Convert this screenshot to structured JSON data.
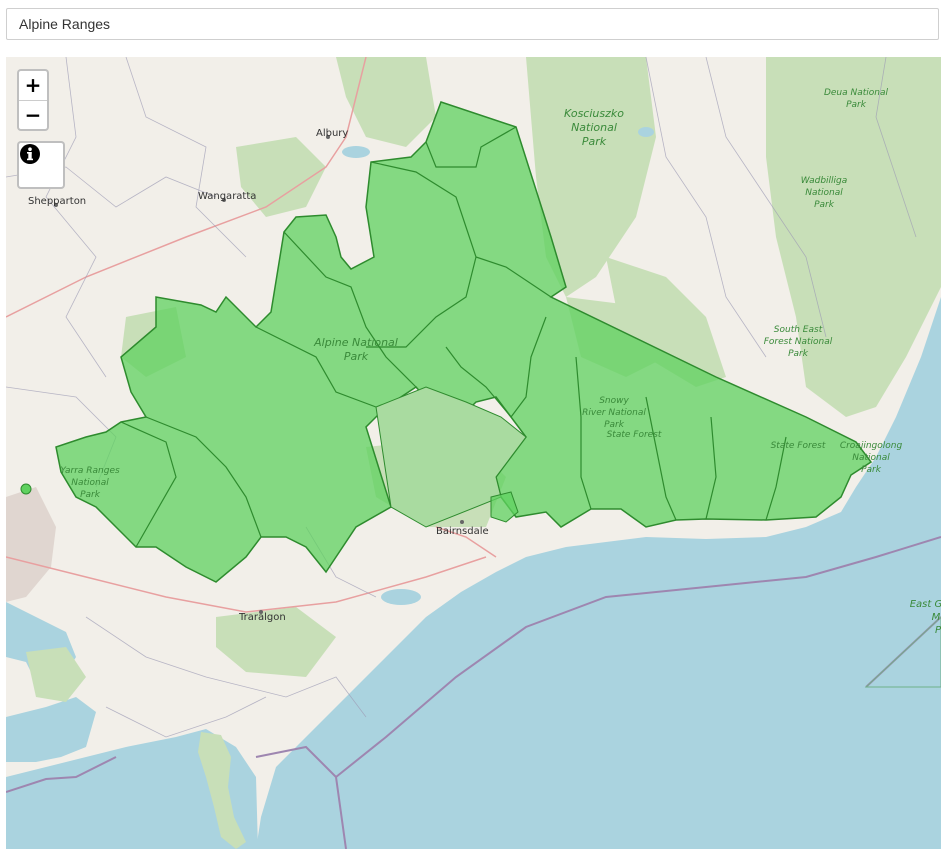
{
  "header": {
    "title": "Alpine Ranges"
  },
  "controls": {
    "zoom_in": "+",
    "zoom_out": "−"
  },
  "icons": {
    "zoom_in": "plus-icon",
    "zoom_out": "minus-icon",
    "info": "info-icon"
  },
  "colors": {
    "sea": "#aad3df",
    "land": "#f2efe9",
    "forest": "#c8dfb8",
    "region_fill": "#5fd15f",
    "region_stroke": "#2e8b2e",
    "park_text": "#3a8a3a",
    "boundary": "#9e9cb5"
  },
  "map": {
    "towns": {
      "albury": "Albury",
      "wangaratta": "Wangaratta",
      "shepparton": "Shepparton",
      "bairnsdale": "Bairnsdale",
      "traralgon": "Traralgon"
    },
    "parks": {
      "kosciuszko": [
        "Kosciuszko",
        "National",
        "Park"
      ],
      "deua": [
        "Deua National",
        "Park"
      ],
      "wadbilliga": [
        "Wadbilliga",
        "National",
        "Park"
      ],
      "south_east_forest": [
        "South East",
        "Forest National",
        "Park"
      ],
      "alpine": [
        "Alpine National",
        "Park"
      ],
      "snowy_river": [
        "Snowy",
        "River National",
        "Park"
      ],
      "state_forest_1": "State Forest",
      "state_forest_2": "State Forest",
      "croajingolong": [
        "Croajingolong",
        "National",
        "Park"
      ],
      "yarra_ranges": [
        "Yarra Ranges",
        "National",
        "Park"
      ],
      "east_gippsland_marine": [
        "East G",
        "M",
        "P"
      ]
    }
  }
}
